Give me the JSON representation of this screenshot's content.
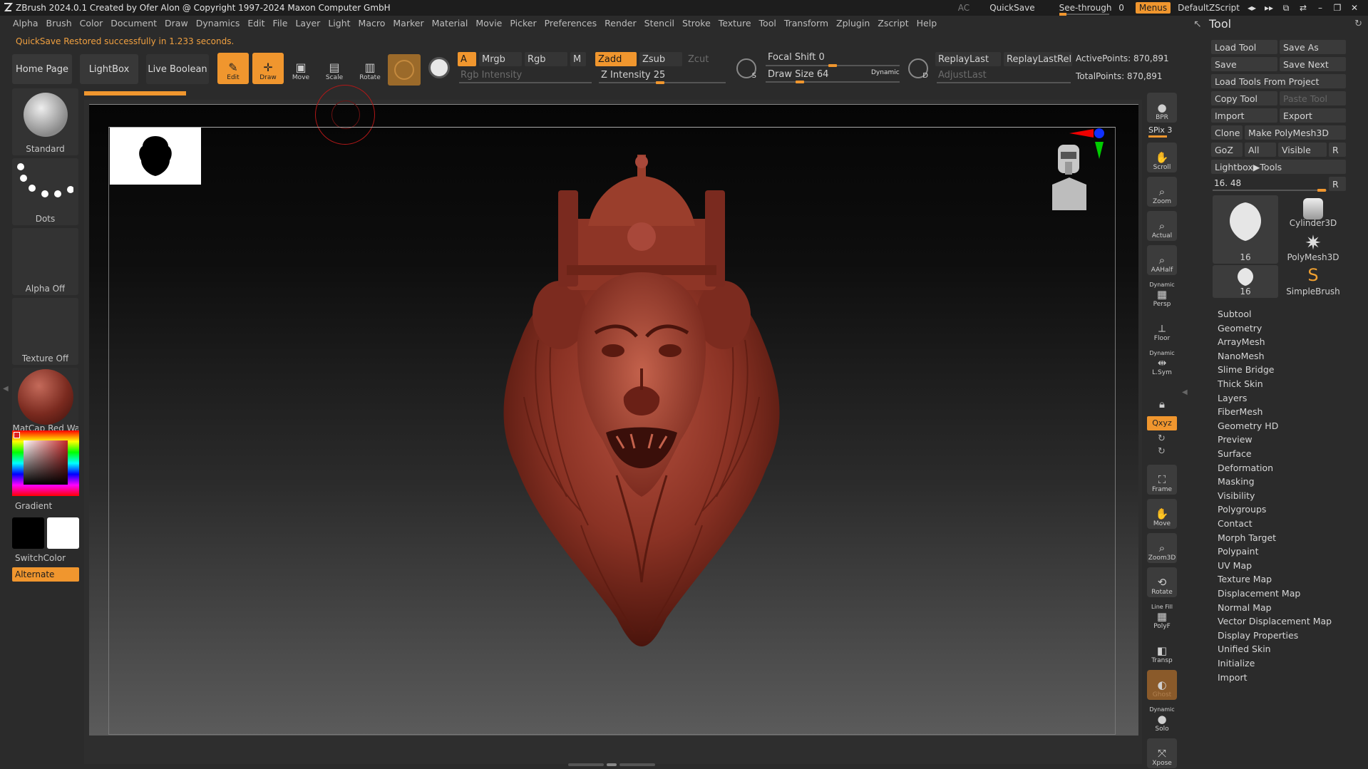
{
  "window": {
    "title": "ZBrush 2024.0.1  Created by Ofer Alon @ Copyright 1997-2024 Maxon Computer GmbH",
    "ac": "AC",
    "quicksave": "QuickSave",
    "see_through": "See-through",
    "see_through_value": "0",
    "menus": "Menus",
    "zscript": "DefaultZScript"
  },
  "menubar": [
    "Alpha",
    "Brush",
    "Color",
    "Document",
    "Draw",
    "Dynamics",
    "Edit",
    "File",
    "Layer",
    "Light",
    "Macro",
    "Marker",
    "Material",
    "Movie",
    "Picker",
    "Preferences",
    "Render",
    "Stencil",
    "Stroke",
    "Texture",
    "Tool",
    "Transform",
    "Zplugin",
    "Zscript",
    "Help"
  ],
  "status_message": "QuickSave Restored successfully in 1.233 seconds.",
  "toolbar": {
    "home_page": "Home Page",
    "lightbox": "LightBox",
    "live_boolean": "Live Boolean",
    "edit": "Edit",
    "draw": "Draw",
    "move": "Move",
    "scale": "Scale",
    "rotate": "Rotate",
    "a": "A",
    "mrgb": "Mrgb",
    "rgb": "Rgb",
    "m": "M",
    "rgb_intensity": "Rgb Intensity",
    "zadd": "Zadd",
    "zsub": "Zsub",
    "zcut": "Zcut",
    "z_intensity": "Z Intensity 25",
    "focal_shift": "Focal Shift 0",
    "draw_size": "Draw Size 64",
    "dynamic": "Dynamic",
    "replay_last": "ReplayLast",
    "replay_last_rel": "ReplayLastRel",
    "adjust_last": "AdjustLast",
    "active_points": "ActivePoints: 870,891",
    "total_points": "TotalPoints: 870,891",
    "s_label": "S",
    "d_label": "D"
  },
  "leftpanel": {
    "brush": "Standard",
    "stroke": "Dots",
    "alpha": "Alpha Off",
    "texture": "Texture Off",
    "material": "MatCap Red Wax",
    "gradient": "Gradient",
    "switchcolor": "SwitchColor",
    "alternate": "Alternate"
  },
  "rightcol": {
    "bpr": "BPR",
    "spix": "SPix 3",
    "scroll": "Scroll",
    "zoom": "Zoom",
    "actual": "Actual",
    "aahalf": "AAHalf",
    "dynamic1": "Dynamic",
    "persp": "Persp",
    "floor": "Floor",
    "dynamic2": "Dynamic",
    "lsym": "L.Sym",
    "xyz": "Qxyz",
    "frame": "Frame",
    "move": "Move",
    "zoom3d": "Zoom3D",
    "rotate": "Rotate",
    "linefill": "Line Fill",
    "polyf": "PolyF",
    "transp": "Transp",
    "ghost": "Ghost",
    "dynamic3": "Dynamic",
    "solo": "Solo",
    "xpose": "Xpose"
  },
  "toolpanel": {
    "title": "Tool",
    "load_tool": "Load Tool",
    "save_as": "Save As",
    "save": "Save",
    "save_next": "Save Next",
    "load_tools_from_project": "Load Tools From Project",
    "copy_tool": "Copy Tool",
    "paste_tool": "Paste Tool",
    "import": "Import",
    "export": "Export",
    "clone": "Clone",
    "make_polymesh": "Make PolyMesh3D",
    "goz": "GoZ",
    "all": "All",
    "visible": "Visible",
    "r": "R",
    "lightbox_tools": "Lightbox▶Tools",
    "tool_count": "16. 48",
    "thumb1_count": "16",
    "thumb2": "Cylinder3D",
    "thumb3": "PolyMesh3D",
    "thumb4_count": "16",
    "thumb5": "SimpleBrush",
    "sections": [
      "Subtool",
      "Geometry",
      "ArrayMesh",
      "NanoMesh",
      "Slime Bridge",
      "Thick Skin",
      "Layers",
      "FiberMesh",
      "Geometry HD",
      "Preview",
      "Surface",
      "Deformation",
      "Masking",
      "Visibility",
      "Polygroups",
      "Contact",
      "Morph Target",
      "Polypaint",
      "UV Map",
      "Texture Map",
      "Displacement Map",
      "Normal Map",
      "Vector Displacement Map",
      "Display Properties",
      "Unified Skin",
      "Initialize",
      "Import"
    ]
  },
  "colors": {
    "accent": "#f0962e",
    "model": "#7a2a1f",
    "background": "#2b2b2b"
  }
}
